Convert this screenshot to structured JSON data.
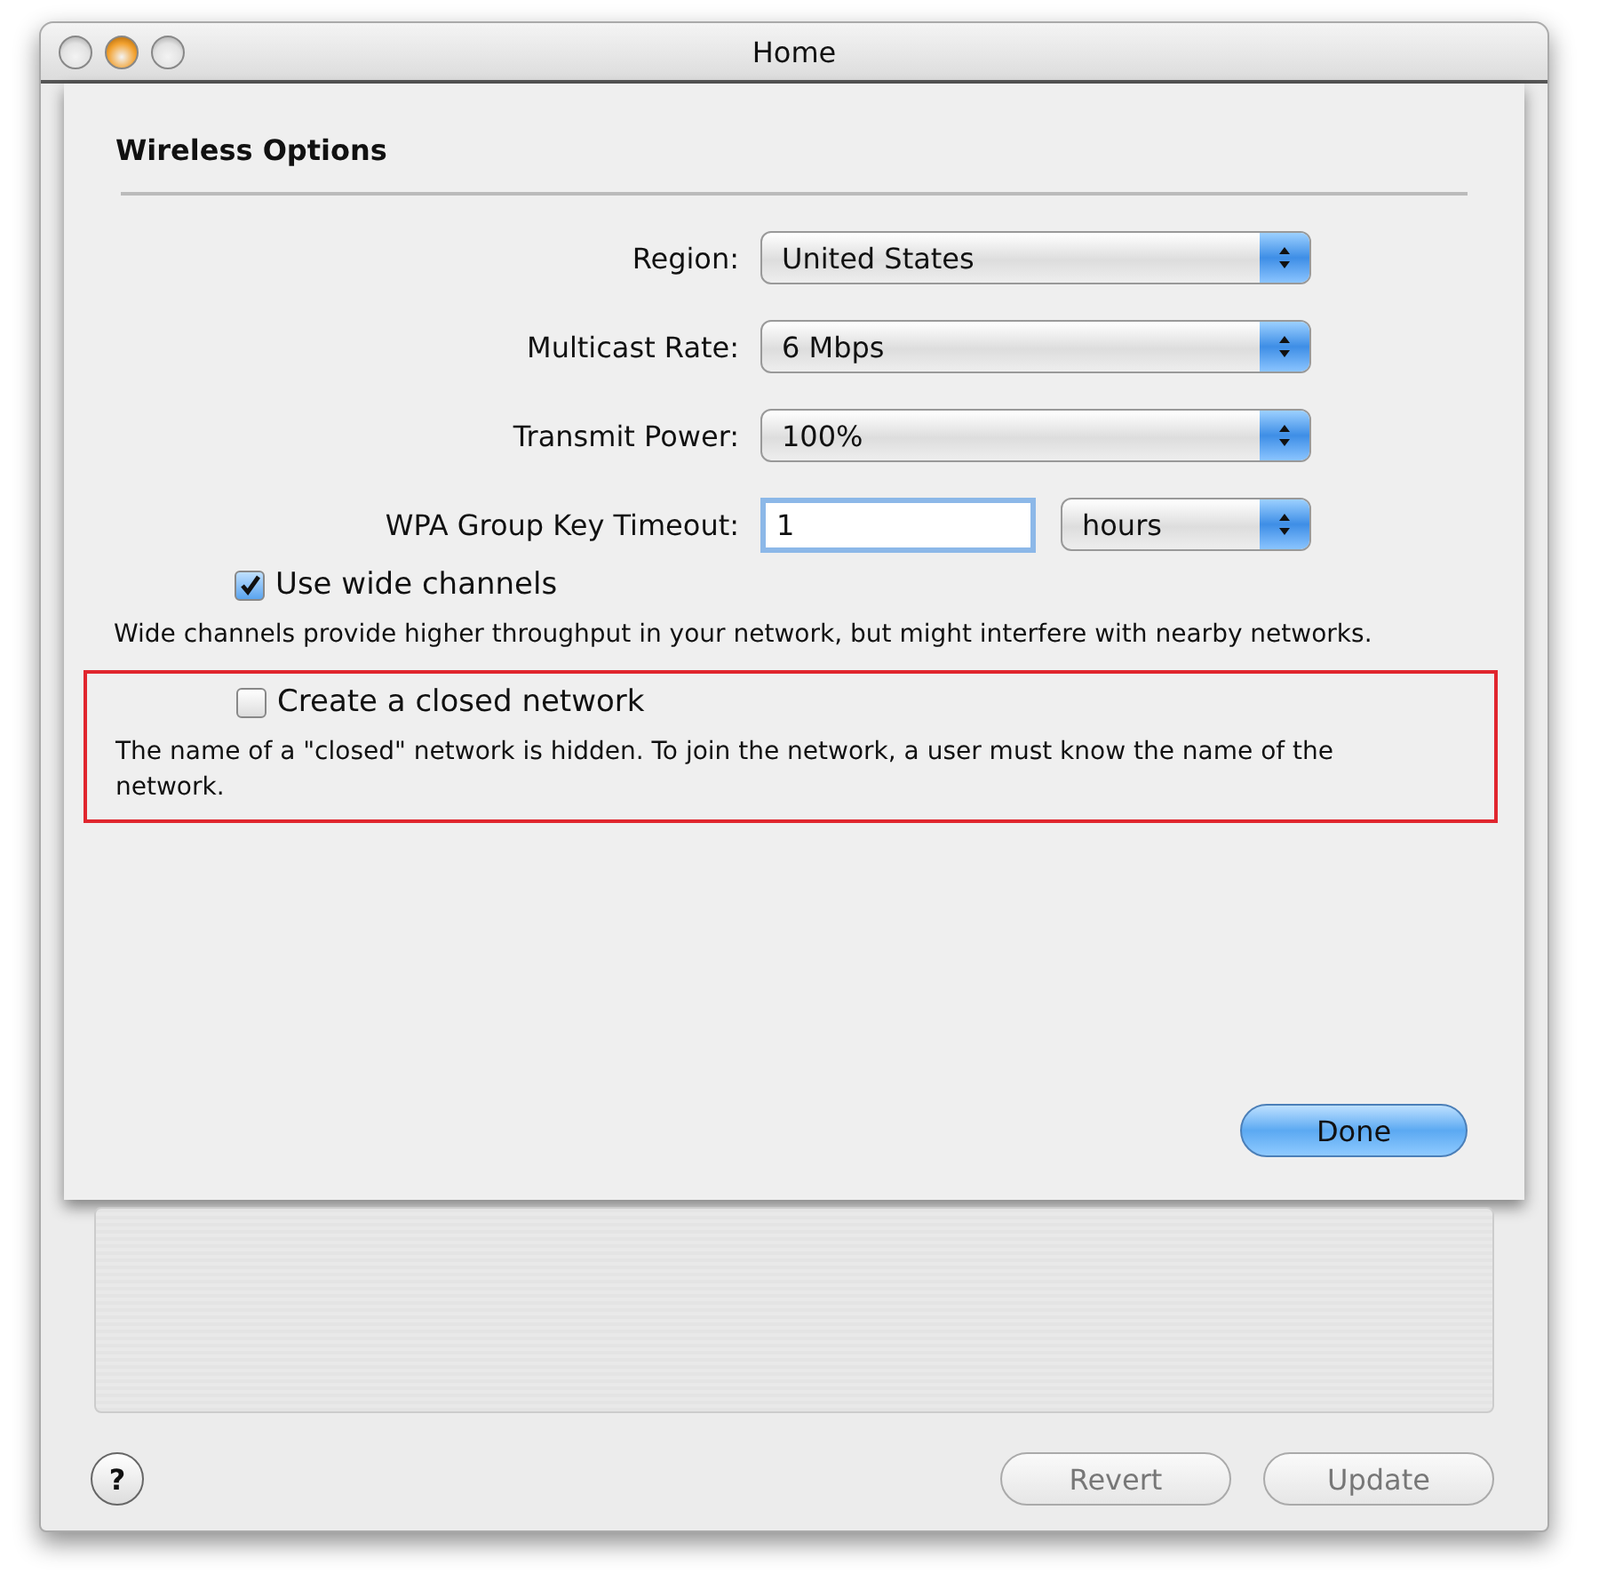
{
  "window": {
    "title": "Home",
    "lights": [
      {
        "kind": "close",
        "lit": false
      },
      {
        "kind": "minimize",
        "lit": true
      },
      {
        "kind": "zoom",
        "lit": false
      }
    ]
  },
  "sheet": {
    "title": "Wireless Options",
    "fields": [
      {
        "kind": "popup",
        "label": "Region:",
        "value": "United States"
      },
      {
        "kind": "popup",
        "label": "Multicast Rate:",
        "value": "6 Mbps"
      },
      {
        "kind": "popup",
        "label": "Transmit Power:",
        "value": "100%"
      },
      {
        "kind": "timeout",
        "label": "WPA Group Key Timeout:",
        "value": "1",
        "unit": "hours"
      }
    ],
    "options": [
      {
        "label": "Use wide channels",
        "checked": true,
        "highlighted": false,
        "note": "Wide channels provide higher throughput in your network, but might interfere with nearby networks."
      },
      {
        "label": "Create a closed network",
        "checked": false,
        "highlighted": true,
        "note": "The name of a \"closed\" network is hidden. To join the network, a user must know the name of the network."
      }
    ],
    "done": "Done"
  },
  "footer": {
    "help": "?",
    "buttons": [
      {
        "label": "Revert",
        "disabled": true
      },
      {
        "label": "Update",
        "disabled": true
      }
    ]
  }
}
